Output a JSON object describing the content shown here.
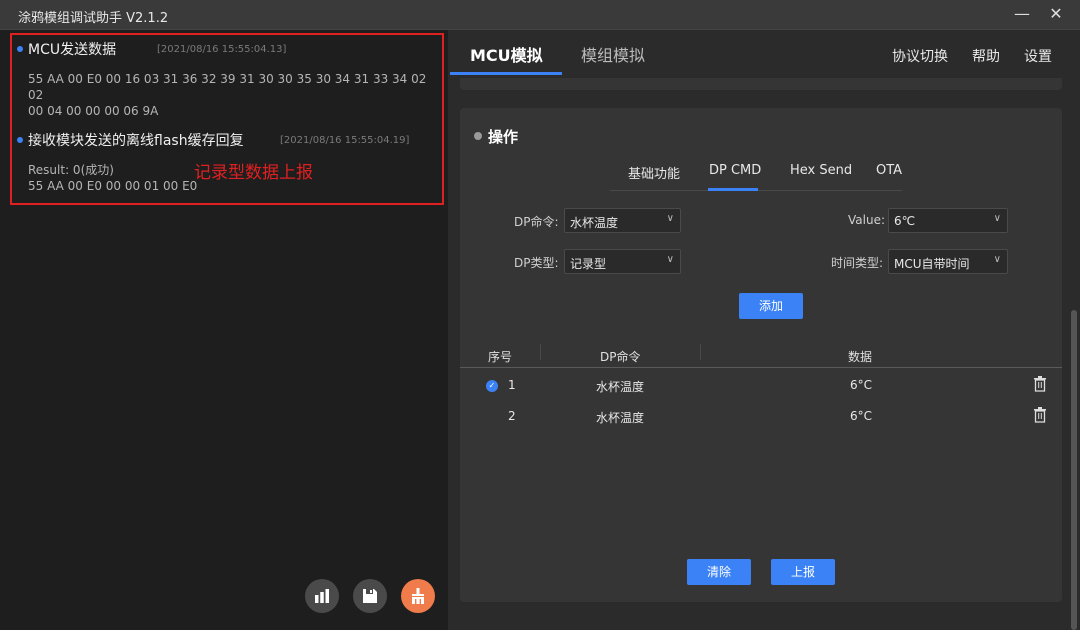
{
  "window": {
    "title": "涂鸦模组调试助手 V2.1.2",
    "minimize_label": "—",
    "close_label": "✕"
  },
  "log": [
    {
      "title": "MCU发送数据",
      "time": "[2021/08/16 15:55:04.13]",
      "lines": [
        "55 AA 00 E0 00 16 03 31 36 32 39 31 30 30 35 30 34 31 33 34 02 02",
        "00 04 00 00 00 06 9A"
      ]
    },
    {
      "title": "接收模块发送的离线flash缓存回复",
      "time": "[2021/08/16 15:55:04.19]",
      "lines": [
        "Result: 0(成功)",
        "55 AA 00 E0 00 00 01 00 E0"
      ]
    }
  ],
  "annotation": "记录型数据上报",
  "left_buttons": {
    "icons": [
      "bar-chart-icon",
      "save-icon",
      "broom-icon"
    ],
    "accent": "#f07b4b"
  },
  "nav": {
    "tabs": [
      "MCU模拟",
      "模组模拟"
    ],
    "links": [
      "协议切换",
      "帮助",
      "设置"
    ]
  },
  "section": {
    "title": "操作",
    "subtabs": [
      "基础功能",
      "DP CMD",
      "Hex Send",
      "OTA"
    ],
    "active_subtab": "DP CMD"
  },
  "form": {
    "dp_cmd_label": "DP命令:",
    "dp_cmd_value": "水杯温度",
    "value_label": "Value:",
    "value_value": "6℃",
    "dp_type_label": "DP类型:",
    "dp_type_value": "记录型",
    "time_type_label": "时间类型:",
    "time_type_value": "MCU自带时间",
    "add_button": "添加"
  },
  "table": {
    "headers": [
      "序号",
      "DP命令",
      "数据"
    ],
    "rows": [
      {
        "index": "1",
        "cmd": "水杯温度",
        "data": "6°C",
        "checked": true
      },
      {
        "index": "2",
        "cmd": "水杯温度",
        "data": "6°C",
        "checked": false
      }
    ]
  },
  "footer": {
    "clear_button": "清除",
    "report_button": "上报"
  },
  "colors": {
    "accent": "#3b82f6",
    "annotation": "#e02020"
  }
}
